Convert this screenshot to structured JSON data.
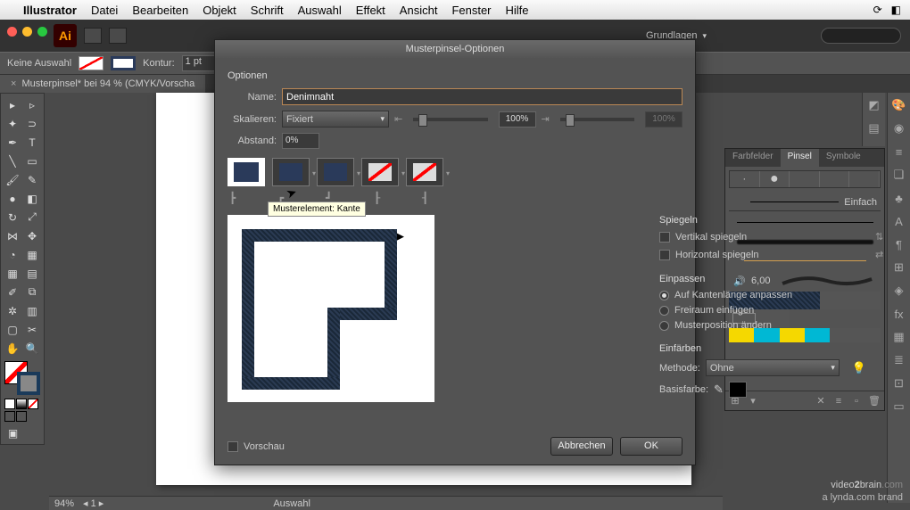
{
  "menubar": {
    "app": "Illustrator",
    "items": [
      "Datei",
      "Bearbeiten",
      "Objekt",
      "Schrift",
      "Auswahl",
      "Effekt",
      "Ansicht",
      "Fenster",
      "Hilfe"
    ]
  },
  "appbar": {
    "essentials": "Grundlagen"
  },
  "controlbar": {
    "selection": "Keine Auswahl",
    "stroke_label": "Kontur:",
    "stroke_value": "1 pt"
  },
  "doc_tab": {
    "title": "Musterpinsel* bei 94 % (CMYK/Vorscha",
    "close": "×"
  },
  "dialog": {
    "title": "Musterpinsel-Optionen",
    "options_label": "Optionen",
    "name_label": "Name:",
    "name_value": "Denimnaht",
    "scale_label": "Skalieren:",
    "scale_select": "Fixiert",
    "scale_pct": "100%",
    "scale_pct2": "100%",
    "spacing_label": "Abstand:",
    "spacing_value": "0%",
    "tooltip": "Musterelement: Kante",
    "mirror_hdr": "Spiegeln",
    "mirror_v": "Vertikal spiegeln",
    "mirror_h": "Horizontal spiegeln",
    "fit_hdr": "Einpassen",
    "fit_opt1": "Auf Kantenlänge anpassen",
    "fit_opt2": "Freiraum einfügen",
    "fit_opt3": "Musterposition ändern",
    "color_hdr": "Einfärben",
    "method_label": "Methode:",
    "method_value": "Ohne",
    "basecolor_label": "Basisfarbe:",
    "preview_label": "Vorschau",
    "cancel": "Abbrechen",
    "ok": "OK"
  },
  "panel": {
    "tabs": [
      "Farbfelder",
      "Pinsel",
      "Symbole"
    ],
    "basic": "Einfach",
    "pt_value": "6,00"
  },
  "statusbar": {
    "zoom": "94%",
    "page": "1",
    "sel": "Auswahl"
  },
  "watermark": {
    "l1a": "video",
    "l1b": "2",
    "l1c": "brain",
    "l1d": ".com",
    "l2": "a lynda.com brand"
  }
}
